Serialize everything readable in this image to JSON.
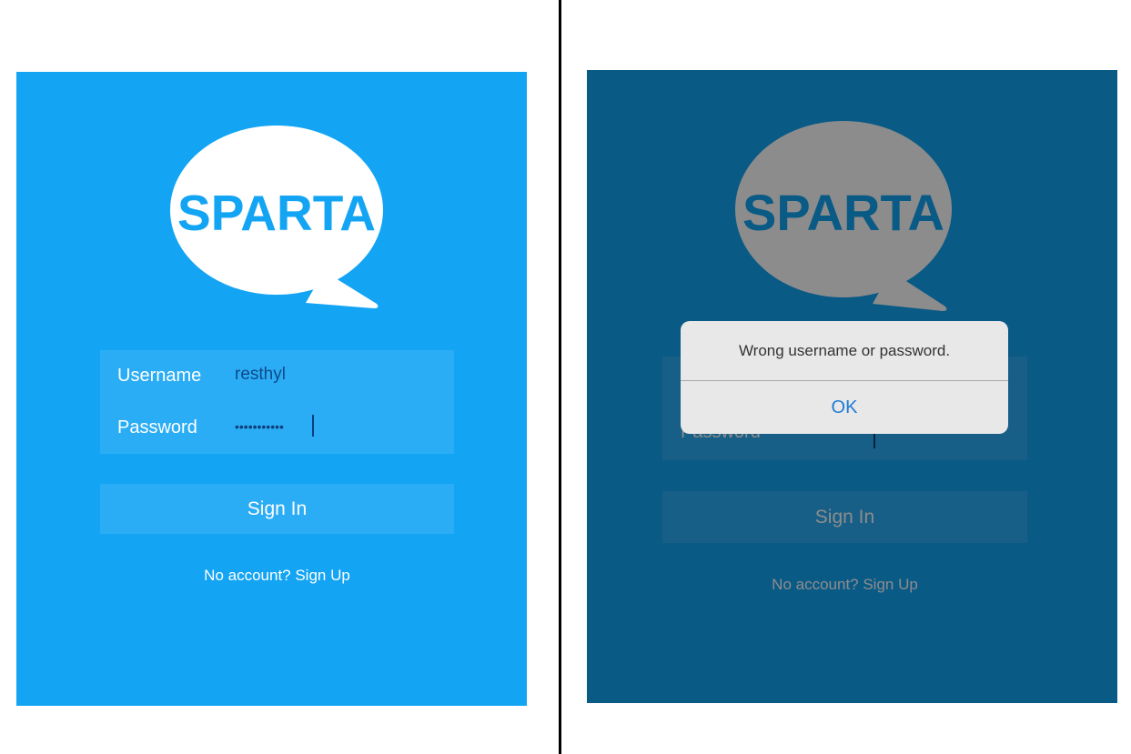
{
  "colors": {
    "screen_background": "#13a4f4",
    "logo_bubble": "#ffffff",
    "logo_text": "#13a4f4",
    "input_text": "#0d4a8c",
    "dialog_background": "#e8e8e8",
    "dialog_button": "#1f7bd6"
  },
  "logo": {
    "text": "SPARTA",
    "icon": "speech-bubble-icon"
  },
  "left_screen": {
    "username_label": "Username",
    "username_value": "resthyl",
    "password_label": "Password",
    "password_masked": "•••••••••••",
    "signin_label": "Sign In",
    "signup_text": "No account? Sign Up"
  },
  "right_screen": {
    "password_label": "Password",
    "signin_label": "Sign In",
    "signup_text": "No account? Sign Up",
    "alert": {
      "message": "Wrong username or password.",
      "ok_label": "OK"
    }
  }
}
